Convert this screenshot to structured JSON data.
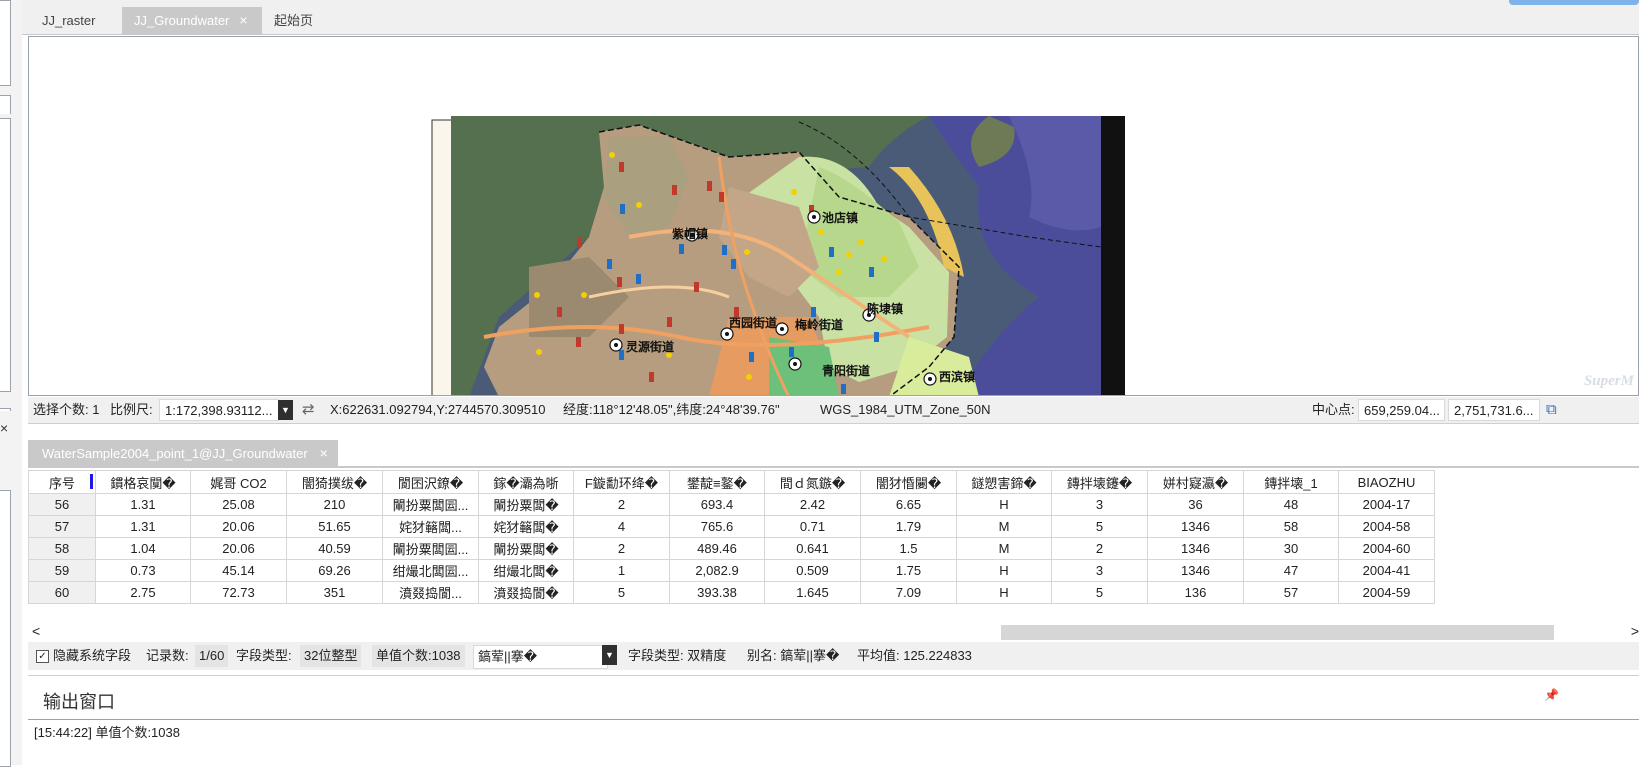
{
  "tabs": {
    "items": [
      {
        "label": "JJ_raster"
      },
      {
        "label": "JJ_Groundwater",
        "close": "×"
      },
      {
        "label": "起始页"
      }
    ]
  },
  "left_panel": {
    "close1": "×",
    "close2": "×"
  },
  "map": {
    "watermark": "SuperM",
    "places": [
      "紫帽镇",
      "池店镇",
      "西园街道",
      "梅岭街道",
      "陈埭镇",
      "灵源街道",
      "青阳街道",
      "西滨镇"
    ]
  },
  "status": {
    "select_count_label": "选择个数: 1",
    "scale_label": "比例尺:",
    "scale_value": "1:172,398.93112...",
    "swap_icon": "⇄",
    "xy": "X:622631.092794,Y:2744570.309510",
    "lonlat": "经度:118°12'48.05\",纬度:24°48'39.76\"",
    "crs": "WGS_1984_UTM_Zone_50N",
    "center_label": "中心点:",
    "center_x": "659,259.04...",
    "center_y": "2,751,731.6..."
  },
  "attr_tab": {
    "label": "WaterSample2004_point_1@JJ_Groundwater",
    "close": "×"
  },
  "table": {
    "columns": [
      "序号",
      "鏆格哀闃�",
      "娓哥  CO2",
      "闇猗撲绂�",
      "閬囨沢鐐�",
      "鎵�灞為晣",
      "F鏇勫环绛�",
      "鐢靛≡鐜�",
      "間ｄ氮鏃�",
      "闇犲惛闄�",
      "鐩愬害鍗�",
      "鏄拌壊鑳�",
      "姘村寲瀛�",
      "鏄拌壊_1",
      "BIAOZHU"
    ],
    "rows": [
      [
        "56",
        "1.31",
        "25.08",
        "210",
        "閳扮粟闆囩...",
        "閳扮粟闆�",
        "2",
        "693.4",
        "2.42",
        "6.65",
        "H",
        "3",
        "36",
        "48",
        "2004-17"
      ],
      [
        "57",
        "1.31",
        "20.06",
        "51.65",
        "姹犲簵闆...",
        "姹犲簵闆�",
        "4",
        "765.6",
        "0.71",
        "1.79",
        "M",
        "5",
        "1346",
        "58",
        "2004-58"
      ],
      [
        "58",
        "1.04",
        "20.06",
        "40.59",
        "閳扮粟闆囩...",
        "閳扮粟闆�",
        "2",
        "489.46",
        "0.641",
        "1.5",
        "M",
        "2",
        "1346",
        "30",
        "2004-60"
      ],
      [
        "59",
        "0.73",
        "45.14",
        "69.26",
        "绀熶北闆囩...",
        "绀熶北闆�",
        "1",
        "2,082.9",
        "0.509",
        "1.75",
        "H",
        "3",
        "1346",
        "47",
        "2004-41"
      ],
      [
        "60",
        "2.75",
        "72.73",
        "351",
        "濆叕捣閬...",
        "濆叕捣閬�",
        "5",
        "393.38",
        "1.645",
        "7.09",
        "H",
        "5",
        "136",
        "57",
        "2004-59"
      ]
    ]
  },
  "scroll": {
    "left": "<",
    "right": ">"
  },
  "attr_bar": {
    "hide_label": "隐藏系统字段",
    "check": "✓",
    "record_label": "记录数:",
    "record_value": "1/60",
    "field_type_label": "字段类型:",
    "field_type_value": "32位整型",
    "unique_label": "单值个数:1038",
    "field_select": "鎬荤||搴�",
    "field_type2": "字段类型:  双精度",
    "alias": "别名:  鎬荤||搴�",
    "avg": "平均值:  125.224833"
  },
  "output": {
    "title": "输出窗口",
    "pin": "📌",
    "line": "[15:44:22] 单值个数:1038"
  }
}
